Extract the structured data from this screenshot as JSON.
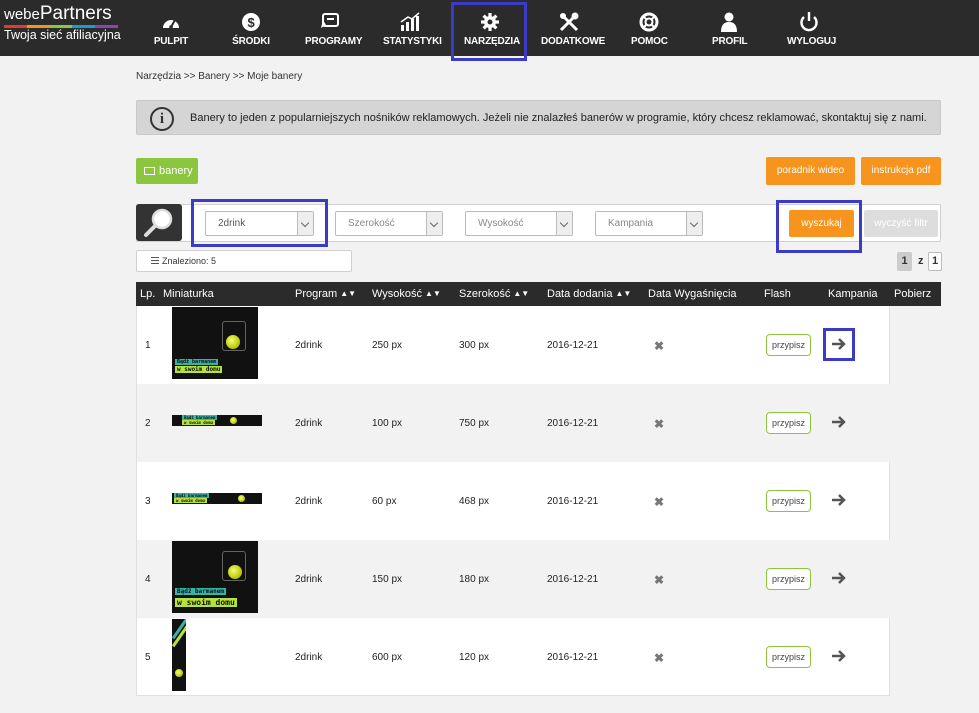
{
  "logo": {
    "brand_prefix": "webe",
    "brand_main": "Partners",
    "tagline": "Twoja sieć afiliacyjna",
    "stripe_colors": [
      "#e5392b",
      "#f7941d",
      "#8cc63f",
      "#1b9ad6",
      "#8e44ad"
    ]
  },
  "nav": [
    {
      "label": "PULPIT",
      "icon": "dashboard-gauge-icon"
    },
    {
      "label": "ŚRODKI",
      "icon": "dollar-icon"
    },
    {
      "label": "PROGRAMY",
      "icon": "programs-icon"
    },
    {
      "label": "STATYSTYKI",
      "icon": "bar-chart-icon"
    },
    {
      "label": "NARZĘDZIA",
      "icon": "gear-icon"
    },
    {
      "label": "DODATKOWE",
      "icon": "tools-icon"
    },
    {
      "label": "POMOC",
      "icon": "lifebuoy-icon"
    },
    {
      "label": "PROFIL",
      "icon": "user-icon"
    },
    {
      "label": "WYLOGUJ",
      "icon": "power-icon"
    }
  ],
  "breadcrumb": "Narzędzia >> Banery >> Moje banery",
  "info": {
    "icon": "info-icon",
    "glyph": "i",
    "text": "Banery to jeden z popularniejszych nośników reklamowych. Jeżeli nie znalazłeś banerów w programie, który chcesz reklamować, skontaktuj się z nami."
  },
  "buttons": {
    "banners": "banery",
    "video_guide": "poradnik wideo",
    "pdf_guide": "instrukcja pdf",
    "search": "wyszukaj",
    "clear": "wyczyść filtr"
  },
  "filters": {
    "program": "2drink",
    "width": "Szerokość",
    "height": "Wysokość",
    "campaign": "Kampania"
  },
  "found": "Znaleziono: 5",
  "pager": {
    "current": "1",
    "of": "z",
    "total": "1"
  },
  "table": {
    "headers": {
      "lp": "Lp.",
      "thumb": "Miniaturka",
      "program": "Program",
      "height": "Wysokość",
      "width": "Szerokość",
      "added": "Data dodania",
      "expires": "Data Wygaśnięcia",
      "flash": "Flash",
      "campaign": "Kampania",
      "download": "Pobierz"
    },
    "assign_label": "przypisz",
    "thumb_texts": {
      "line1": "Bądź barmanem",
      "line2": "w swoim domu"
    },
    "rows": [
      {
        "lp": "1",
        "program": "2drink",
        "height": "250 px",
        "width": "300 px",
        "added": "2016-12-21"
      },
      {
        "lp": "2",
        "program": "2drink",
        "height": "100 px",
        "width": "750 px",
        "added": "2016-12-21"
      },
      {
        "lp": "3",
        "program": "2drink",
        "height": "60 px",
        "width": "468 px",
        "added": "2016-12-21"
      },
      {
        "lp": "4",
        "program": "2drink",
        "height": "150 px",
        "width": "180 px",
        "added": "2016-12-21"
      },
      {
        "lp": "5",
        "program": "2drink",
        "height": "600 px",
        "width": "120 px",
        "added": "2016-12-21"
      }
    ]
  },
  "colors": {
    "accent_orange": "#f7941d",
    "accent_green": "#8cc63f",
    "highlight": "#3b3bc8",
    "dark_bar": "#2b2b2b"
  }
}
